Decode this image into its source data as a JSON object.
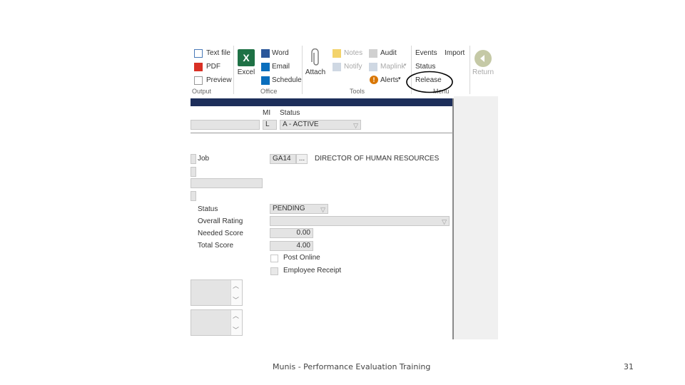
{
  "ribbon": {
    "output": {
      "text_file": "Text file",
      "pdf": "PDF",
      "preview": "Preview",
      "group_label": "Output"
    },
    "office": {
      "excel": "Excel",
      "word": "Word",
      "email": "Email",
      "schedule": "Schedule",
      "group_label": "Office"
    },
    "tools": {
      "attach": "Attach",
      "notes": "Notes",
      "notify": "Notify",
      "audit": "Audit",
      "maplink": "Maplink",
      "alerts": "Alerts",
      "group_label": "Tools"
    },
    "menu": {
      "events": "Events",
      "import": "Import",
      "status": "Status",
      "release": "Release",
      "group_label": "Menu"
    },
    "return": "Return"
  },
  "header": {
    "mi_label": "MI",
    "status_label": "Status",
    "mi_value": "L",
    "status_value": "A - ACTIVE"
  },
  "form": {
    "job_label": "Job",
    "job_code": "GA14",
    "lookup": "...",
    "job_title": "DIRECTOR OF HUMAN RESOURCES",
    "status_label": "Status",
    "status_value": "PENDING",
    "overall_rating_label": "Overall Rating",
    "overall_rating_value": "",
    "needed_score_label": "Needed Score",
    "needed_score_value": "0.00",
    "total_score_label": "Total Score",
    "total_score_value": "4.00",
    "post_online_label": "Post Online",
    "employee_receipt_label": "Employee Receipt"
  },
  "footer": {
    "caption": "Munis - Performance Evaluation Training",
    "page_number": "31"
  },
  "colors": {
    "header_bar": "#1d2e5a",
    "annotation_circle": "#000000",
    "excel_green": "#1e7145",
    "word_blue": "#2b579a"
  }
}
